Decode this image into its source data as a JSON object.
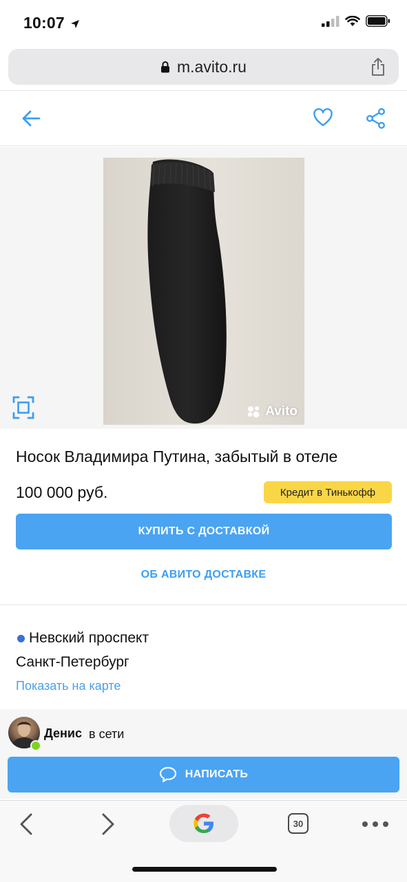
{
  "status_bar": {
    "time": "10:07"
  },
  "browser": {
    "url": "m.avito.ru",
    "tab_count": "30"
  },
  "listing": {
    "title": "Носок Владимира Путина, забытый в отеле",
    "price": "100 000 руб.",
    "credit_badge": "Кредит в Тинькофф",
    "buy_button": "КУПИТЬ С ДОСТАВКОЙ",
    "about_delivery_link": "ОБ АВИТО ДОСТАВКЕ",
    "watermark": "Avito"
  },
  "location": {
    "metro": "Невский проспект",
    "city": "Санкт-Петербург",
    "map_link": "Показать на карте"
  },
  "seller": {
    "name": "Денис",
    "status": "в сети",
    "write_button": "НАПИСАТЬ"
  },
  "colors": {
    "accent_blue": "#4aa4f2",
    "link_blue": "#3d9ef0",
    "badge_yellow": "#f9d646",
    "online_green": "#7ed321"
  }
}
